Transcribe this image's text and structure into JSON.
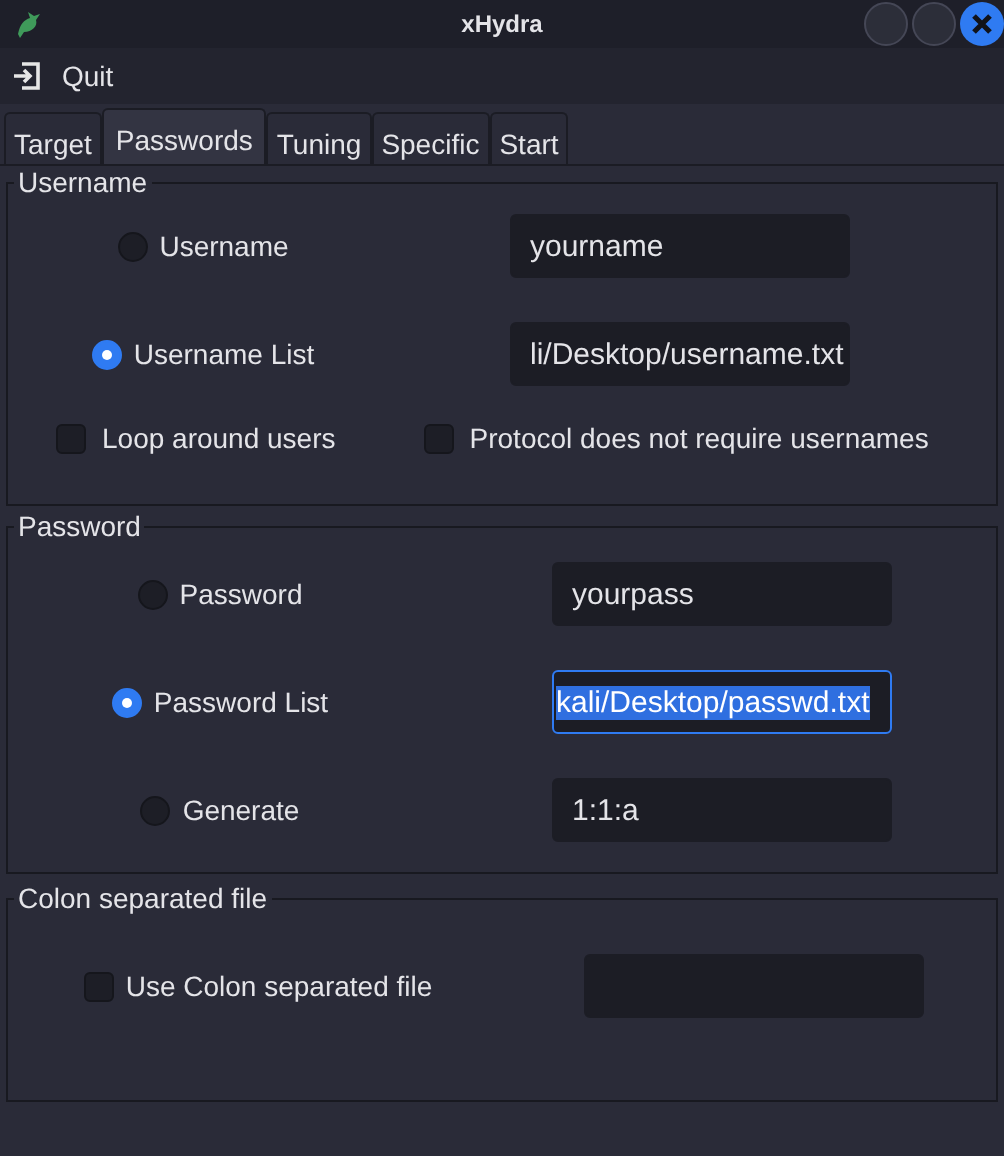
{
  "window": {
    "title": "xHydra"
  },
  "menu": [
    {
      "label": "Quit"
    }
  ],
  "tabs": [
    {
      "label": "Target",
      "selected": false
    },
    {
      "label": "Passwords",
      "selected": true
    },
    {
      "label": "Tuning",
      "selected": false
    },
    {
      "label": "Specific",
      "selected": false
    },
    {
      "label": "Start",
      "selected": false
    }
  ],
  "username": {
    "title": "Username",
    "options": [
      {
        "label": "Username",
        "selected": false,
        "value": "yourname",
        "focused": false
      },
      {
        "label": "Username List",
        "selected": true,
        "value": "li/Desktop/username.txt",
        "focused": false
      }
    ],
    "checks": [
      {
        "label": "Loop around users",
        "checked": false
      },
      {
        "label": "Protocol does not require usernames",
        "checked": false
      }
    ]
  },
  "password": {
    "title": "Password",
    "options": [
      {
        "label": "Password",
        "selected": false,
        "value": "yourpass",
        "focused": false
      },
      {
        "label": "Password List",
        "selected": true,
        "value": "kali/Desktop/passwd.txt",
        "focused": true
      },
      {
        "label": "Generate",
        "selected": false,
        "value": "1:1:a",
        "focused": false
      }
    ]
  },
  "colon": {
    "title": "Colon separated file",
    "checks": [
      {
        "label": "Use Colon separated file",
        "checked": false
      }
    ]
  }
}
